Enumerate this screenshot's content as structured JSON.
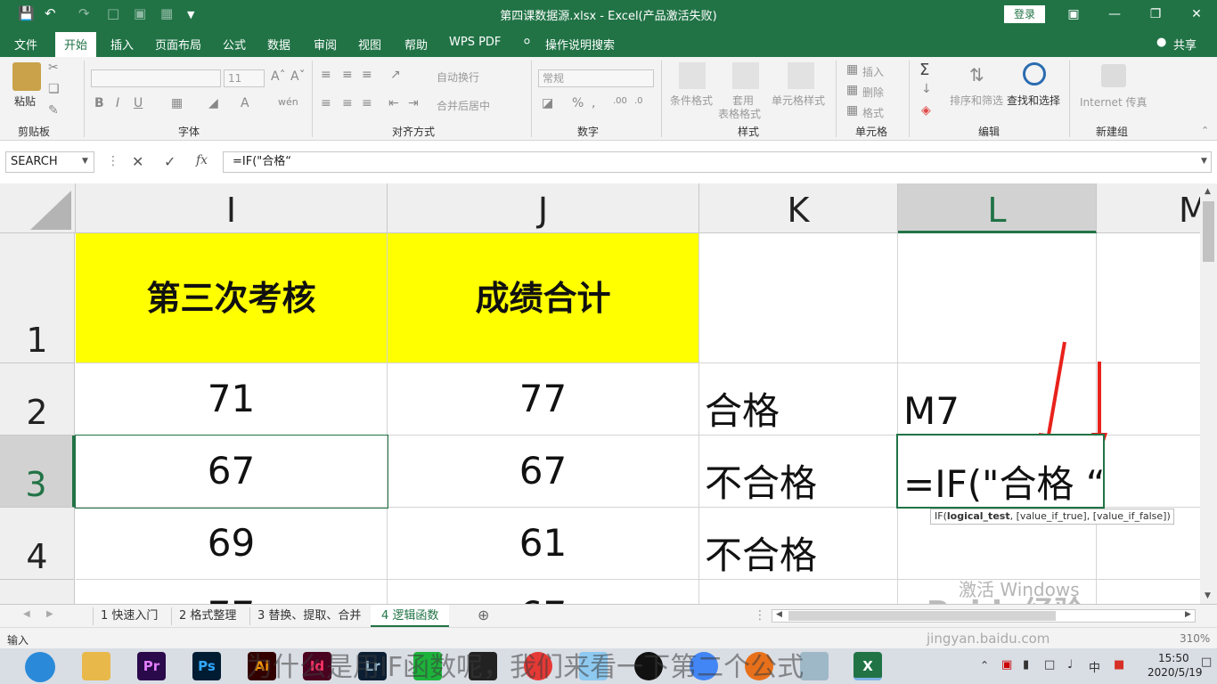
{
  "window": {
    "title": "第四课数据源.xlsx  -  Excel(产品激活失败)",
    "login_label": "登录",
    "share_label": "共享"
  },
  "tabs": [
    "文件",
    "开始",
    "插入",
    "页面布局",
    "公式",
    "数据",
    "审阅",
    "视图",
    "帮助",
    "WPS PDF"
  ],
  "tell_me": "操作说明搜索",
  "ribbon": {
    "paste": "粘贴",
    "clipboard": "剪贴板",
    "font": "字体",
    "alignment": "对齐方式",
    "number": "数字",
    "styles": "样式",
    "cells": "单元格",
    "editing": "编辑",
    "new_group": "新建组",
    "font_size": "11",
    "wrap_text": "自动换行",
    "merge_center": "合并后居中",
    "number_format": "常规",
    "cond_format": "条件格式",
    "table_format_1": "套用",
    "table_format_2": "表格格式",
    "cell_styles": "单元格样式",
    "insert": "插入",
    "delete": "删除",
    "format": "格式",
    "sort_filter": "排序和筛选",
    "find_select": "查找和选择",
    "internet_fax": "Internet 传真"
  },
  "formula_bar": {
    "name_box": "SEARCH",
    "formula": "=IF(\"合格“"
  },
  "columns": [
    "I",
    "J",
    "K",
    "L",
    "M"
  ],
  "rows": [
    "1",
    "2",
    "3",
    "4"
  ],
  "cells": {
    "I1": "第三次考核",
    "J1": "成绩合计",
    "I2": "71",
    "J2": "77",
    "K2": "合格",
    "L2": "M7",
    "I3": "67",
    "J3": "67",
    "K3": "不合格",
    "L3": "=IF(\"合格   “",
    "I4": "69",
    "J4": "61",
    "K4": "不合格",
    "I5": "77",
    "J5": "67"
  },
  "tooltip": {
    "func": "IF(",
    "arg1": "logical_test",
    "rest": ", [value_if_true], [value_if_false])"
  },
  "sheets": [
    "1 快速入门",
    "2 格式整理",
    "3 替换、提取、合并",
    "4 逻辑函数"
  ],
  "status": {
    "mode": "输入",
    "zoom": "310%"
  },
  "taskbar": {
    "apps": [
      "Pr",
      "Ps",
      "Ai",
      "Id",
      "Lr"
    ],
    "time": "15:50",
    "date": "2020/5/19",
    "ime": "中"
  },
  "watermark": {
    "activate": "激活 Windows",
    "baidu": "Baidu经验",
    "site": "jingyan.baidu.com",
    "caption": "为什么是用IF函数呢，我们来看一下第二个公式"
  },
  "colors": {
    "excel_green": "#217346",
    "header_yellow": "#ffff00",
    "arrow_red": "#e8221c"
  }
}
